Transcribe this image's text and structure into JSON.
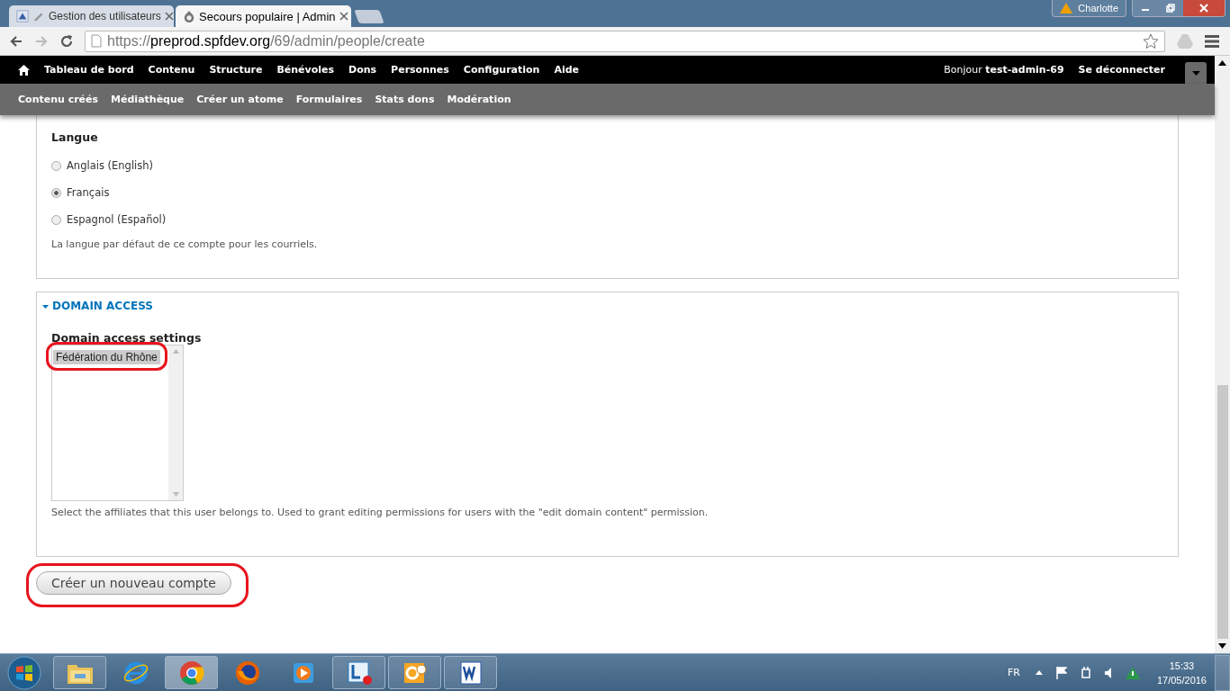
{
  "browser": {
    "tabs": [
      {
        "title": "Gestion des utilisateurs",
        "selected": false,
        "kind": "site"
      },
      {
        "title": "Secours populaire | Admin",
        "selected": true,
        "kind": "drupal"
      }
    ],
    "profile": "Charlotte",
    "url": {
      "scheme": "https://",
      "host": "preprod.spfdev.org",
      "path": "/69/admin/people/create"
    }
  },
  "admin_menu": {
    "items": [
      "Tableau de bord",
      "Contenu",
      "Structure",
      "Bénévoles",
      "Dons",
      "Personnes",
      "Configuration",
      "Aide"
    ],
    "greeting": "Bonjour **test-admin-69**",
    "logout": "Se déconnecter"
  },
  "shortcuts": [
    "Contenu créés",
    "Médiathèque",
    "Créer un atome",
    "Formulaires",
    "Stats dons",
    "Modération"
  ],
  "language": {
    "label": "Langue",
    "options": [
      {
        "label": "Anglais (English)",
        "selected": false
      },
      {
        "label": "Français",
        "selected": true
      },
      {
        "label": "Espagnol (Español)",
        "selected": false
      }
    ],
    "description": "La langue par défaut de ce compte pour les courriels."
  },
  "domain_access": {
    "title": "DOMAIN ACCESS",
    "expanded": true,
    "label": "Domain access settings",
    "options": [
      {
        "label": "Fédération du Rhône",
        "selected": true,
        "highlighted": true
      }
    ],
    "description": "Select the affiliates that this user belongs to. Used to grant editing permissions for users with the \"edit domain content\" permission."
  },
  "submit": {
    "label": "Créer un nouveau compte",
    "highlighted": true
  },
  "taskbar": {
    "apps": [
      {
        "kind": "explorer",
        "running": true,
        "selected": false
      },
      {
        "kind": "ie",
        "running": false,
        "selected": false
      },
      {
        "kind": "chrome",
        "running": true,
        "selected": true
      },
      {
        "kind": "firefox",
        "running": false,
        "selected": false
      },
      {
        "kind": "media",
        "running": false,
        "selected": false
      },
      {
        "kind": "lync",
        "running": true,
        "selected": false
      },
      {
        "kind": "outlook",
        "running": true,
        "selected": false
      },
      {
        "kind": "word",
        "running": true,
        "selected": false
      }
    ],
    "language": "FR",
    "time": "15:33",
    "date": "17/05/2016"
  }
}
